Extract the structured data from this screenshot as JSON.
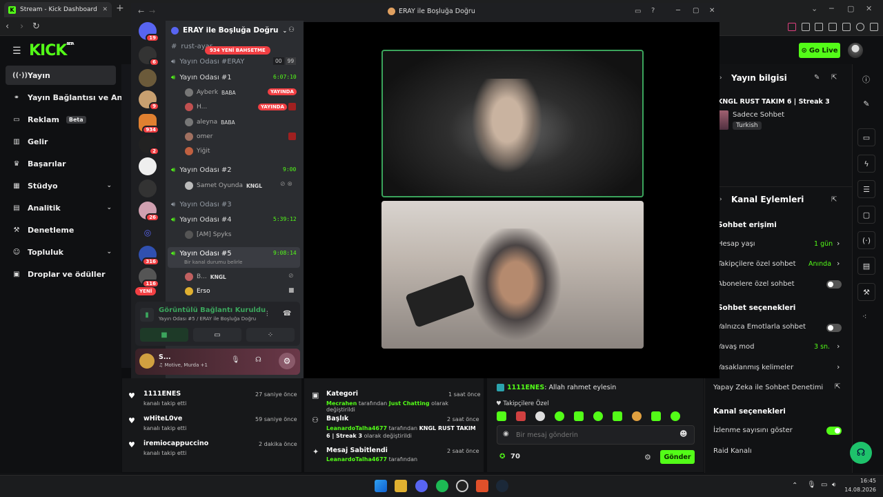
{
  "browser": {
    "tab_title": "Stream - Kick Dashboard",
    "new_tab": "+"
  },
  "kick": {
    "logo": "KICK",
    "logo_sup": "BETA",
    "go_live": "Go Live",
    "sidebar": [
      {
        "label": "Yayın",
        "icon": "broadcast-icon",
        "active": true
      },
      {
        "label": "Yayın Bağlantısı ve Anahtarı",
        "icon": "link-icon"
      },
      {
        "label": "Reklam",
        "icon": "ad-icon",
        "badge": "Beta"
      },
      {
        "label": "Gelir",
        "icon": "revenue-icon"
      },
      {
        "label": "Başarılar",
        "icon": "trophy-icon"
      },
      {
        "label": "Stüdyo",
        "icon": "studio-icon",
        "chevron": true
      },
      {
        "label": "Analitik",
        "icon": "chart-icon",
        "chevron": true
      },
      {
        "label": "Denetleme",
        "icon": "hammer-icon"
      },
      {
        "label": "Topluluk",
        "icon": "community-icon",
        "chevron": true
      },
      {
        "label": "Droplar ve ödüller",
        "icon": "gift-icon"
      }
    ],
    "stream_info": {
      "heading": "Yayın bilgisi",
      "title": "KNGL RUST TAKIM 6 | Streak 3",
      "category": "Sadece Sohbet",
      "tag": "Turkish"
    },
    "channel_actions": {
      "heading": "Kanal Eylemleri",
      "chat_access": "Sohbet erişimi",
      "account_age": "Hesap yaşı",
      "account_age_val": "1 gün",
      "followers_only": "Takipçilere özel sohbet",
      "followers_only_val": "Anında",
      "subs_only": "Abonelere özel sohbet",
      "chat_options": "Sohbet seçenekleri",
      "emote_only": "Yalnızca Emotlarla sohbet",
      "slow_mode": "Yavaş mod",
      "slow_mode_val": "3 sn.",
      "banned_words": "Yasaklanmış kelimeler",
      "ai_moderation": "Yapay Zeka ile Sohbet Denetimi",
      "channel_options": "Kanal seçenekleri",
      "show_views": "İzlenme sayısını göster",
      "raid": "Raid Kanalı"
    },
    "followers": [
      {
        "name": "1111ENES",
        "sub": "kanalı takip etti",
        "time": "27 saniye önce"
      },
      {
        "name": "wHiteL0ve",
        "sub": "kanalı takip etti",
        "time": "59 saniye önce"
      },
      {
        "name": "iremiocappuccino",
        "sub": "kanalı takip etti",
        "time": "2 dakika önce"
      }
    ],
    "activity": [
      {
        "title": "Kategori",
        "time": "1 saat önce",
        "who": "Mecrahen",
        "rest1": " tarafından ",
        "hl": "Just Chatting",
        "rest2": " olarak değiştirildi"
      },
      {
        "title": "Başlık",
        "time": "2 saat önce",
        "who": "LeanardoTalha4677",
        "rest1": " tarafından ",
        "hl": "KNGL RUST TAKIM 6 | Streak 3",
        "rest2": " olarak değiştirildi"
      },
      {
        "title": "Mesaj Sabitlendi",
        "time": "2 saat önce",
        "who": "LeanardoTalha4677",
        "rest1": " tarafından",
        "hl": "",
        "rest2": ""
      }
    ],
    "chat": {
      "msg_user": "1111ENES",
      "msg_text": ": Allah rahmet eylesin",
      "followers_label": "Takipçilere Özel",
      "placeholder": "Bir mesaj gönderin",
      "points": "70",
      "send": "Gönder"
    }
  },
  "discord": {
    "window_title": "ERAY ile Boşluğa Doğru",
    "server_name": "ERAY ile Boşluğa Doğru",
    "mention_banner": "934 YENİ BAHSETME",
    "new_badge": "YENİ",
    "server_badges": [
      "19",
      "6",
      "9",
      "934",
      "2",
      "",
      "",
      "26",
      "",
      "316",
      "116"
    ],
    "channels": {
      "top": "rust-ayar",
      "erav": "Yayın Odası #ERAY",
      "erav_counts": [
        "00",
        "99"
      ],
      "room1": "Yayın Odası #1",
      "room1_time": "6:07:10",
      "room1_users": [
        {
          "name": "Ayberk",
          "tag": "BABA",
          "live": "YAYINDA"
        },
        {
          "name": "H...",
          "tag": "",
          "live": "YAYINDA"
        },
        {
          "name": "aleyna",
          "tag": "BABA",
          "live": ""
        },
        {
          "name": "omer",
          "tag": "",
          "live": ""
        },
        {
          "name": "Yiğit",
          "tag": "",
          "live": ""
        }
      ],
      "room2": "Yayın Odası #2",
      "room2_time": "9:00",
      "room2_user": "Samet Oyunda",
      "room2_tag": "KNGL",
      "room3": "Yayın Odası #3",
      "room4": "Yayın Odası #4",
      "room4_time": "5:39:12",
      "room4_user": "[AM] Spyks",
      "room5": "Yayın Odası #5",
      "room5_time": "9:08:14",
      "room5_status": "Bir kanal durumu belirle",
      "room5_users": [
        {
          "name": "B...",
          "tag": "KNGL"
        },
        {
          "name": "Erso",
          "tag": ""
        }
      ]
    },
    "voice": {
      "status": "Görüntülü Bağlantı Kuruldu",
      "where": "Yayın Odası #5 / ERAY ile Boşluğa Doğru"
    },
    "user": {
      "name": "S...",
      "activity": "Motive, Murda +1"
    }
  },
  "taskbar": {
    "time": "16:45",
    "date": "14.08.2026"
  }
}
